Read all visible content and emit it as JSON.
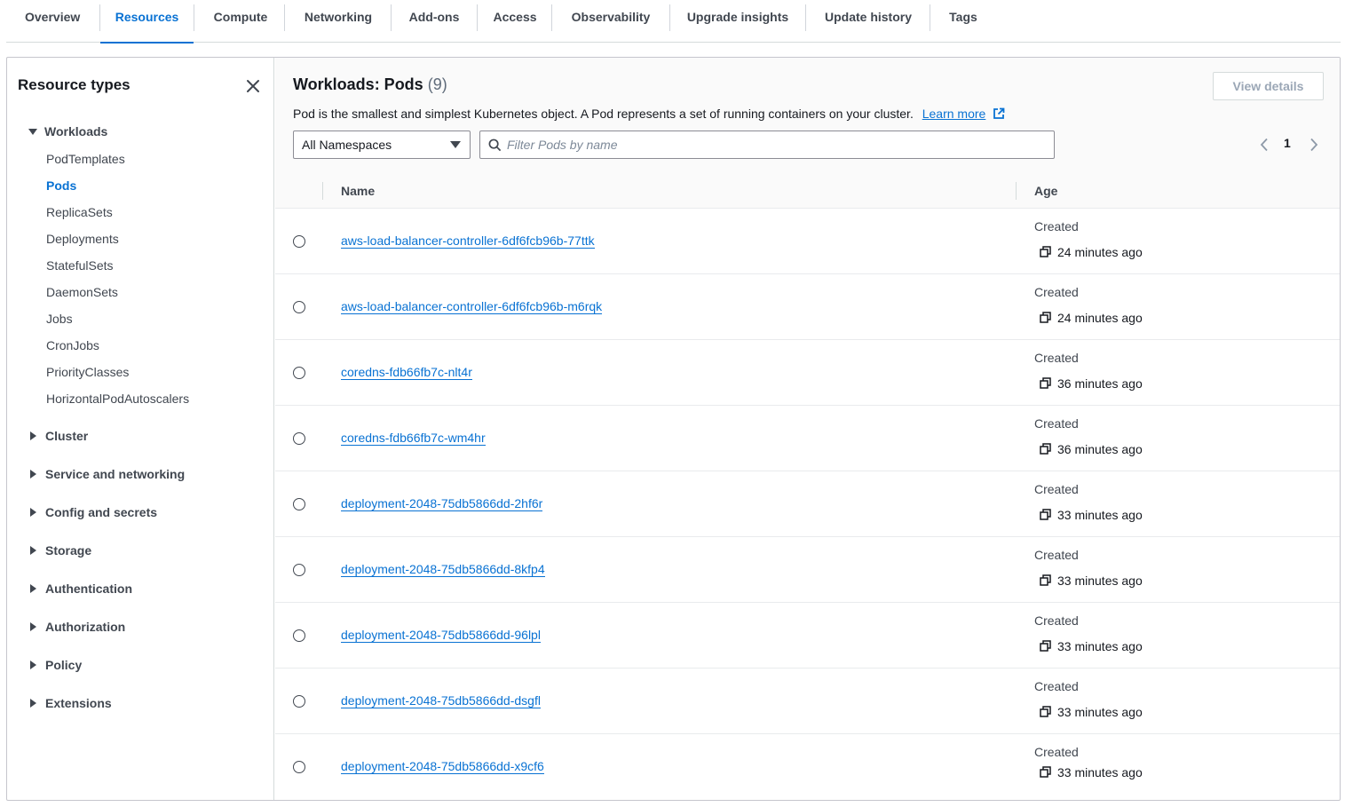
{
  "tabs": [
    {
      "label": "Overview"
    },
    {
      "label": "Resources",
      "active": true
    },
    {
      "label": "Compute"
    },
    {
      "label": "Networking"
    },
    {
      "label": "Add-ons"
    },
    {
      "label": "Access"
    },
    {
      "label": "Observability"
    },
    {
      "label": "Upgrade insights"
    },
    {
      "label": "Update history"
    },
    {
      "label": "Tags"
    }
  ],
  "sidebar": {
    "title": "Resource types",
    "close_icon": "close-icon",
    "workloads": {
      "label": "Workloads",
      "expanded": true,
      "items": [
        {
          "label": "PodTemplates"
        },
        {
          "label": "Pods",
          "active": true
        },
        {
          "label": "ReplicaSets"
        },
        {
          "label": "Deployments"
        },
        {
          "label": "StatefulSets"
        },
        {
          "label": "DaemonSets"
        },
        {
          "label": "Jobs"
        },
        {
          "label": "CronJobs"
        },
        {
          "label": "PriorityClasses"
        },
        {
          "label": "HorizontalPodAutoscalers"
        }
      ]
    },
    "groups": [
      {
        "label": "Cluster"
      },
      {
        "label": "Service and networking"
      },
      {
        "label": "Config and secrets"
      },
      {
        "label": "Storage"
      },
      {
        "label": "Authentication"
      },
      {
        "label": "Authorization"
      },
      {
        "label": "Policy"
      },
      {
        "label": "Extensions"
      }
    ]
  },
  "main": {
    "title": "Workloads: Pods",
    "count": "(9)",
    "view_details_label": "View details",
    "description": "Pod is the smallest and simplest Kubernetes object. A Pod represents a set of running containers on your cluster.",
    "learn_more": "Learn more",
    "namespace_select": "All Namespaces",
    "filter_placeholder": "Filter Pods by name",
    "page": "1",
    "columns": {
      "name": "Name",
      "age": "Age"
    },
    "rows": [
      {
        "name": "aws-load-balancer-controller-6df6fcb96b-77ttk",
        "created_label": "Created",
        "age": "24 minutes ago"
      },
      {
        "name": "aws-load-balancer-controller-6df6fcb96b-m6rqk",
        "created_label": "Created",
        "age": "24 minutes ago"
      },
      {
        "name": "coredns-fdb66fb7c-nlt4r",
        "created_label": "Created",
        "age": "36 minutes ago"
      },
      {
        "name": "coredns-fdb66fb7c-wm4hr",
        "created_label": "Created",
        "age": "36 minutes ago"
      },
      {
        "name": "deployment-2048-75db5866dd-2hf6r",
        "created_label": "Created",
        "age": "33 minutes ago"
      },
      {
        "name": "deployment-2048-75db5866dd-8kfp4",
        "created_label": "Created",
        "age": "33 minutes ago"
      },
      {
        "name": "deployment-2048-75db5866dd-96lpl",
        "created_label": "Created",
        "age": "33 minutes ago"
      },
      {
        "name": "deployment-2048-75db5866dd-dsgfl",
        "created_label": "Created",
        "age": "33 minutes ago"
      },
      {
        "name": "deployment-2048-75db5866dd-x9cf6",
        "created_label": "Created",
        "age": "33 minutes ago"
      }
    ]
  },
  "colors": {
    "accent": "#0972d3",
    "text": "#16191f",
    "muted": "#414750",
    "border": "#d5dbdb"
  }
}
